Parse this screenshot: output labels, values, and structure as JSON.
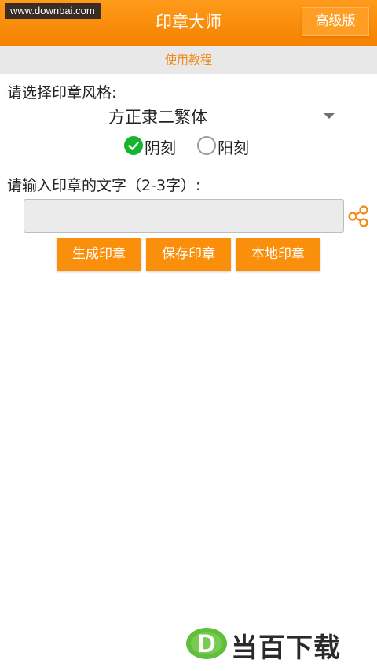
{
  "watermark_top": "www.downbai.com",
  "header": {
    "title": "印章大师",
    "premium_label": "高级版"
  },
  "tutorial": {
    "label": "使用教程"
  },
  "style_section": {
    "label": "请选择印章风格:",
    "selected_font": "方正隶二繁体",
    "radio_yin": {
      "label": "阴刻",
      "checked": true
    },
    "radio_yang": {
      "label": "阳刻",
      "checked": false
    }
  },
  "text_section": {
    "label": "请输入印章的文字（2-3字）:",
    "input_value": "",
    "input_placeholder": ""
  },
  "buttons": {
    "generate": "生成印章",
    "save": "保存印章",
    "local": "本地印章"
  },
  "bottom_watermark": {
    "letter": "D",
    "text": "当百下载"
  },
  "colors": {
    "header_orange": "#f98f0b",
    "check_green": "#16b32e",
    "tutorial_text": "#ee8a14"
  },
  "icons": {
    "share": "share-icon",
    "dropdown": "dropdown-arrow-icon",
    "check": "check-icon"
  }
}
